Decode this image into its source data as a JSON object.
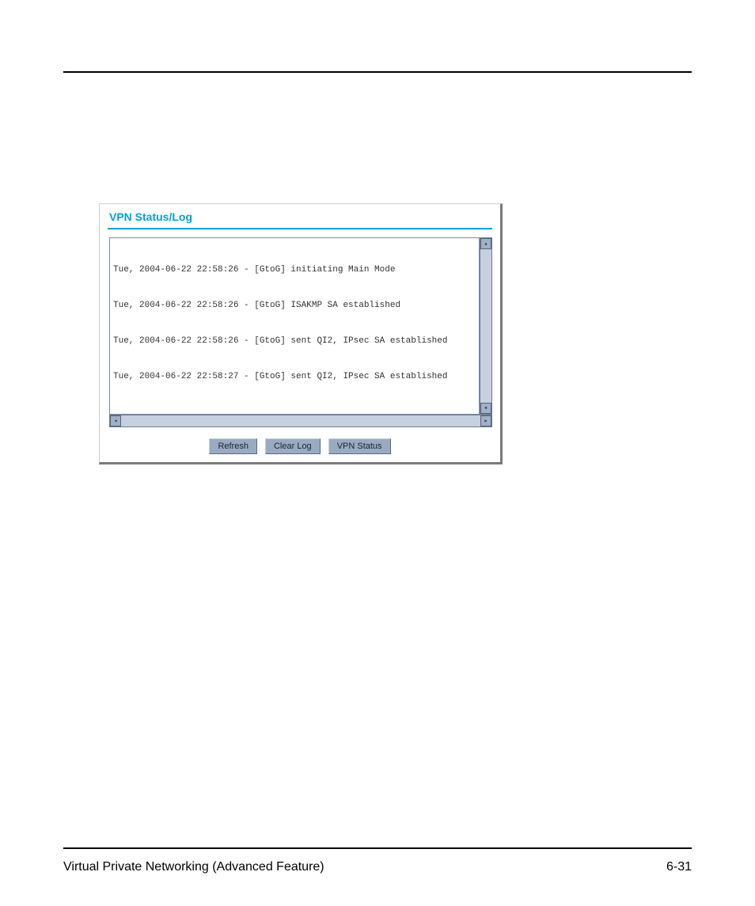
{
  "panel": {
    "title": "VPN Status/Log"
  },
  "log": {
    "lines": [
      "Tue, 2004-06-22 22:58:26 - [GtoG] initiating Main Mode",
      "Tue, 2004-06-22 22:58:26 - [GtoG] ISAKMP SA established",
      "Tue, 2004-06-22 22:58:26 - [GtoG] sent QI2, IPsec SA established",
      "Tue, 2004-06-22 22:58:27 - [GtoG] sent QI2, IPsec SA established"
    ]
  },
  "buttons": {
    "refresh": "Refresh",
    "clear": "Clear Log",
    "status": "VPN Status"
  },
  "footer": {
    "section": "Virtual Private Networking (Advanced Feature)",
    "page": "6-31"
  }
}
